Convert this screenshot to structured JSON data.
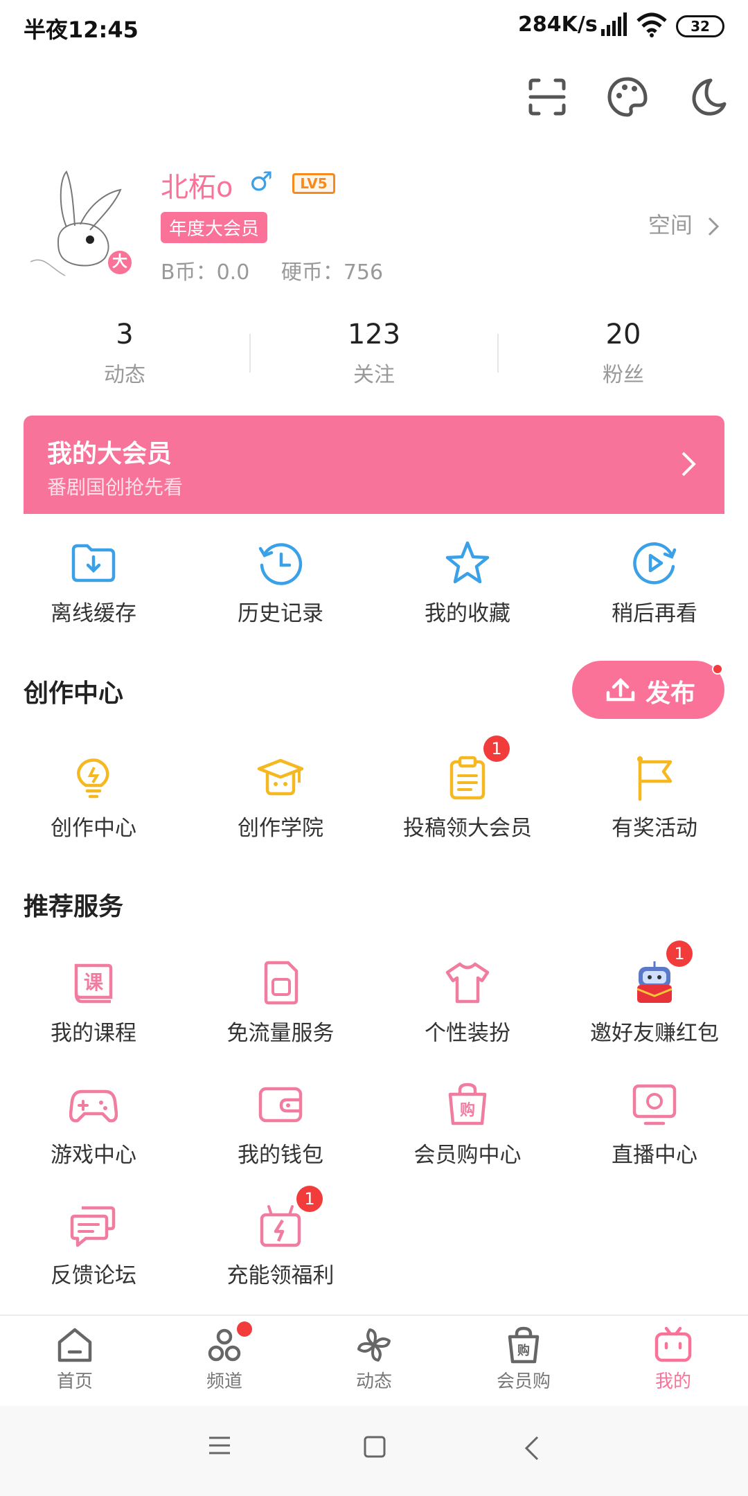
{
  "status_bar": {
    "time": "半夜12:45",
    "net_speed": "284K/s",
    "battery": "32"
  },
  "profile": {
    "username": "北柘o",
    "gender_symbol": "♂",
    "level": "LV5",
    "avatar_badge": "大",
    "vip_tag": "年度大会员",
    "bcoin": "B币：0.0",
    "coin": "硬币：756",
    "space_link": "空间"
  },
  "stats": [
    {
      "value": "3",
      "label": "动态"
    },
    {
      "value": "123",
      "label": "关注"
    },
    {
      "value": "20",
      "label": "粉丝"
    }
  ],
  "vip_banner": {
    "title": "我的大会员",
    "subtitle": "番剧国创抢先看"
  },
  "quick_actions": [
    {
      "label": "离线缓存",
      "icon": "download-folder-icon"
    },
    {
      "label": "历史记录",
      "icon": "history-clock-icon"
    },
    {
      "label": "我的收藏",
      "icon": "star-icon"
    },
    {
      "label": "稍后再看",
      "icon": "watch-later-icon"
    }
  ],
  "creation": {
    "title": "创作中心",
    "publish_label": "发布",
    "items": [
      {
        "label": "创作中心",
        "icon": "lightbulb-icon"
      },
      {
        "label": "创作学院",
        "icon": "graduation-cap-icon"
      },
      {
        "label": "投稿领大会员",
        "icon": "clipboard-icon",
        "badge": "1"
      },
      {
        "label": "有奖活动",
        "icon": "flag-icon"
      }
    ]
  },
  "services": {
    "title": "推荐服务",
    "items": [
      {
        "label": "我的课程",
        "icon": "course-book-icon",
        "glyph": "课"
      },
      {
        "label": "免流量服务",
        "icon": "sim-card-icon"
      },
      {
        "label": "个性装扮",
        "icon": "tshirt-icon"
      },
      {
        "label": "邀好友赚红包",
        "icon": "red-packet-robot-icon",
        "badge": "1"
      },
      {
        "label": "游戏中心",
        "icon": "gamepad-icon"
      },
      {
        "label": "我的钱包",
        "icon": "wallet-icon"
      },
      {
        "label": "会员购中心",
        "icon": "shopping-bag-icon",
        "glyph": "购"
      },
      {
        "label": "直播中心",
        "icon": "live-tv-icon"
      },
      {
        "label": "反馈论坛",
        "icon": "chat-bubbles-icon"
      },
      {
        "label": "充能领福利",
        "icon": "gift-bolt-icon",
        "badge": "1"
      }
    ]
  },
  "bottom_nav": [
    {
      "label": "首页",
      "icon": "home-icon"
    },
    {
      "label": "频道",
      "icon": "channel-icon",
      "dot": true
    },
    {
      "label": "动态",
      "icon": "pinwheel-icon"
    },
    {
      "label": "会员购",
      "icon": "shop-bag-icon",
      "glyph": "购"
    },
    {
      "label": "我的",
      "icon": "bilibili-tv-icon",
      "active": true
    }
  ],
  "colors": {
    "accent_pink": "#fb7299",
    "blue": "#3aa0e8",
    "yellow": "#f5b820",
    "badge_red": "#f23b3b"
  }
}
